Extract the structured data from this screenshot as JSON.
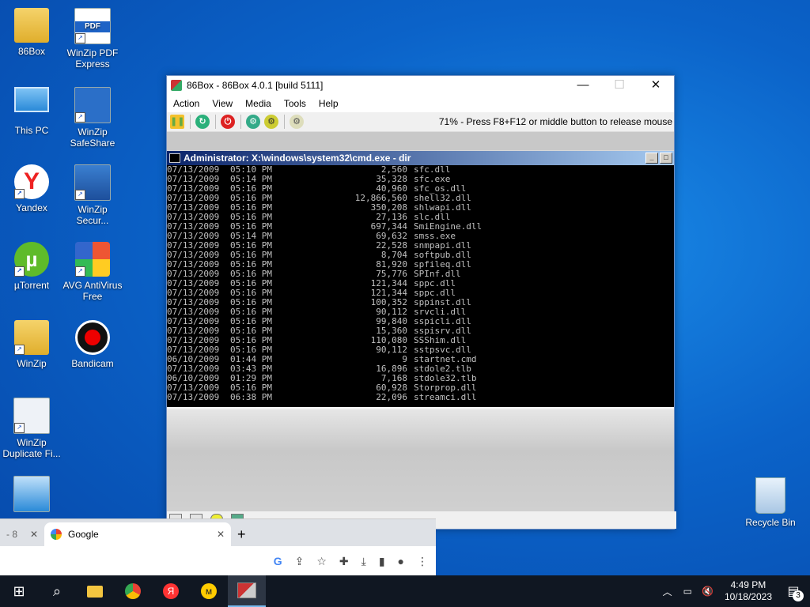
{
  "desktop": {
    "icons": [
      {
        "label": "86Box"
      },
      {
        "label": "WinZip PDF Express"
      },
      {
        "label": "This PC"
      },
      {
        "label": "WinZip SafeShare"
      },
      {
        "label": "Yandex"
      },
      {
        "label": "WinZip Secur..."
      },
      {
        "label": "µTorrent"
      },
      {
        "label": "AVG AntiVirus Free"
      },
      {
        "label": "WinZip"
      },
      {
        "label": "Bandicam"
      },
      {
        "label": "WinZip Duplicate Fi..."
      },
      {
        "label": "Recycle Bin"
      }
    ]
  },
  "window": {
    "title": "86Box - 86Box 4.0.1 [build 5111]",
    "menu": [
      "Action",
      "View",
      "Media",
      "Tools",
      "Help"
    ],
    "status_msg": "71% - Press F8+F12 or middle button to release mouse",
    "cmd_title": "Administrator: X:\\windows\\system32\\cmd.exe - dir",
    "rows": [
      [
        "07/13/2009",
        "05:10 PM",
        "2,560",
        "sfc.dll"
      ],
      [
        "07/13/2009",
        "05:14 PM",
        "35,328",
        "sfc.exe"
      ],
      [
        "07/13/2009",
        "05:16 PM",
        "40,960",
        "sfc_os.dll"
      ],
      [
        "07/13/2009",
        "05:16 PM",
        "12,866,560",
        "shell32.dll"
      ],
      [
        "07/13/2009",
        "05:16 PM",
        "350,208",
        "shlwapi.dll"
      ],
      [
        "07/13/2009",
        "05:16 PM",
        "27,136",
        "slc.dll"
      ],
      [
        "07/13/2009",
        "05:16 PM",
        "697,344",
        "SmiEngine.dll"
      ],
      [
        "07/13/2009",
        "05:14 PM",
        "69,632",
        "smss.exe"
      ],
      [
        "07/13/2009",
        "05:16 PM",
        "22,528",
        "snmpapi.dll"
      ],
      [
        "07/13/2009",
        "05:16 PM",
        "8,704",
        "softpub.dll"
      ],
      [
        "07/13/2009",
        "05:16 PM",
        "81,920",
        "spfileq.dll"
      ],
      [
        "07/13/2009",
        "05:16 PM",
        "75,776",
        "SPInf.dll"
      ],
      [
        "07/13/2009",
        "05:16 PM",
        "121,344",
        "sppc.dll"
      ],
      [
        "07/13/2009",
        "05:16 PM",
        "121,344",
        "sppc.dll"
      ],
      [
        "07/13/2009",
        "05:16 PM",
        "100,352",
        "sppinst.dll"
      ],
      [
        "07/13/2009",
        "05:16 PM",
        "90,112",
        "srvcli.dll"
      ],
      [
        "07/13/2009",
        "05:16 PM",
        "99,840",
        "sspicli.dll"
      ],
      [
        "07/13/2009",
        "05:16 PM",
        "15,360",
        "sspisrv.dll"
      ],
      [
        "07/13/2009",
        "05:16 PM",
        "110,080",
        "SSShim.dll"
      ],
      [
        "07/13/2009",
        "05:16 PM",
        "90,112",
        "sstpsvc.dll"
      ],
      [
        "06/10/2009",
        "01:44 PM",
        "9",
        "startnet.cmd"
      ],
      [
        "07/13/2009",
        "03:43 PM",
        "16,896",
        "stdole2.tlb"
      ],
      [
        "06/10/2009",
        "01:29 PM",
        "7,168",
        "stdole32.tlb"
      ],
      [
        "07/13/2009",
        "05:16 PM",
        "60,928",
        "Storprop.dll"
      ],
      [
        "07/13/2009",
        "06:38 PM",
        "22,096",
        "streamci.dll"
      ]
    ]
  },
  "chrome": {
    "prev_tab": "- 8",
    "tab_label": "Google"
  },
  "taskbar": {
    "time": "4:49 PM",
    "date": "10/18/2023",
    "notifications": "3"
  }
}
